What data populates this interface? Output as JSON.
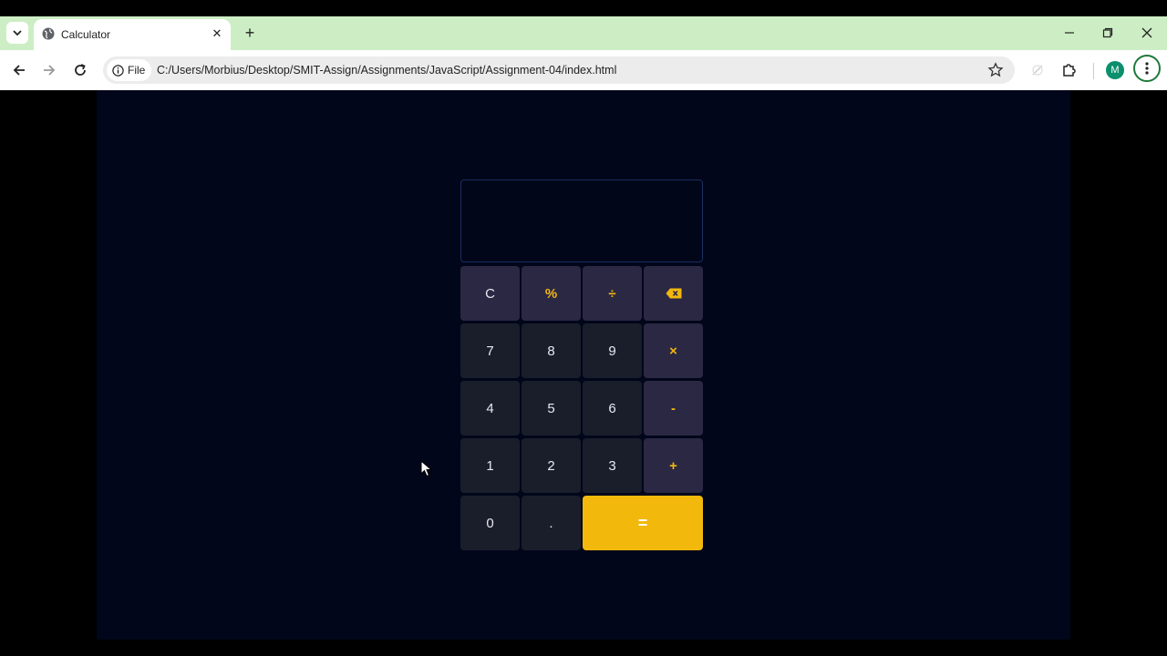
{
  "browser": {
    "tab_title": "Calculator",
    "new_tab_label": "+",
    "address_chip": "File",
    "url": "C:/Users/Morbius/Desktop/SMIT-Assign/Assignments/JavaScript/Assignment-04/index.html",
    "profile_initial": "M",
    "tabbar_color": "#cdeec5"
  },
  "calculator": {
    "display_value": "",
    "keys": [
      {
        "label": "C",
        "kind": "func"
      },
      {
        "label": "%",
        "kind": "func-accent"
      },
      {
        "label": "÷",
        "kind": "op"
      },
      {
        "label": "⌫",
        "kind": "op",
        "icon": "backspace-icon"
      },
      {
        "label": "7",
        "kind": "num"
      },
      {
        "label": "8",
        "kind": "num"
      },
      {
        "label": "9",
        "kind": "num"
      },
      {
        "label": "×",
        "kind": "op"
      },
      {
        "label": "4",
        "kind": "num"
      },
      {
        "label": "5",
        "kind": "num"
      },
      {
        "label": "6",
        "kind": "num"
      },
      {
        "label": "-",
        "kind": "op"
      },
      {
        "label": "1",
        "kind": "num"
      },
      {
        "label": "2",
        "kind": "num"
      },
      {
        "label": "3",
        "kind": "num"
      },
      {
        "label": "+",
        "kind": "op"
      },
      {
        "label": "0",
        "kind": "num"
      },
      {
        "label": ".",
        "kind": "num"
      },
      {
        "label": "=",
        "kind": "equals"
      }
    ],
    "colors": {
      "background": "#01061a",
      "key_number": "#1a1e2b",
      "key_operator": "#2b2844",
      "accent": "#f2b70f",
      "equals": "#f2b90c"
    }
  }
}
